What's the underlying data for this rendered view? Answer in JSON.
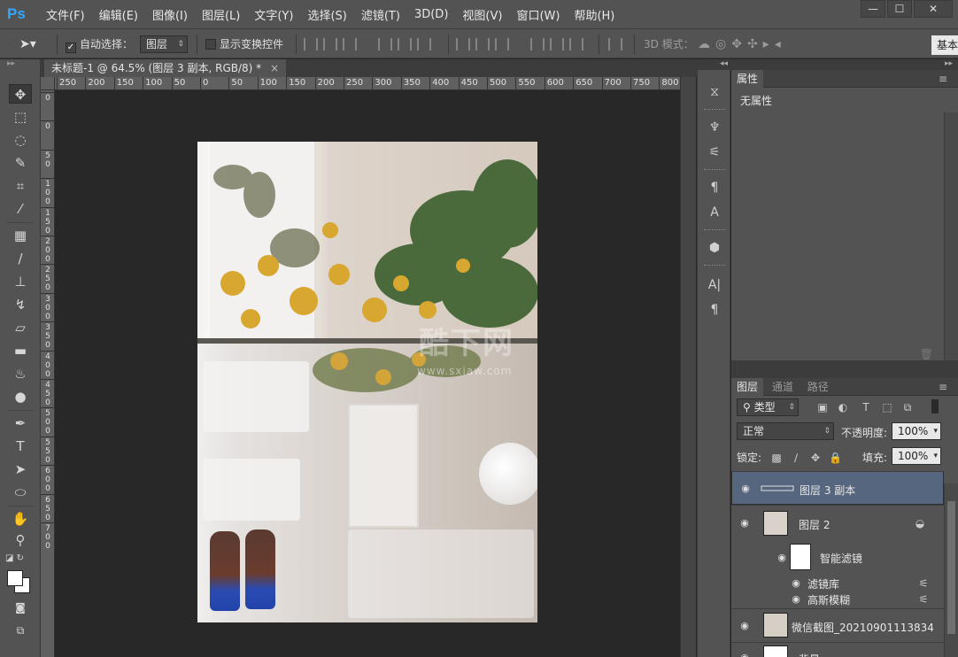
{
  "app": {
    "logo": "Ps",
    "menus": [
      "文件(F)",
      "编辑(E)",
      "图像(I)",
      "图层(L)",
      "文字(Y)",
      "选择(S)",
      "滤镜(T)",
      "3D(D)",
      "视图(V)",
      "窗口(W)",
      "帮助(H)"
    ],
    "window_buttons": {
      "minimize": "—",
      "maximize": "☐",
      "close": "✕"
    }
  },
  "options_bar": {
    "auto_select_label": "自动选择：",
    "auto_select_checked": true,
    "auto_select_target": "图层",
    "show_transform_label": "显示变换控件",
    "show_transform_checked": false,
    "mode_3d_label": "3D 模式：",
    "workspace": "基本"
  },
  "document": {
    "tab_title": "未标题-1 @ 64.5% (图层 3 副本, RGB/8) *",
    "tab_close": "×",
    "ruler_h": [
      "250",
      "200",
      "150",
      "100",
      "50",
      "0",
      "50",
      "100",
      "150",
      "200",
      "250",
      "300",
      "350",
      "400",
      "450",
      "500",
      "550",
      "600",
      "650",
      "700",
      "750",
      "800"
    ],
    "ruler_v": [
      "0",
      "0",
      "50",
      "100",
      "150",
      "200",
      "250",
      "300",
      "350",
      "400",
      "450",
      "500",
      "550",
      "600",
      "650",
      "700"
    ],
    "watermark": "酷下网",
    "watermark_url": "www.sxiaw.com"
  },
  "properties_panel": {
    "tab": "属性",
    "empty_text": "无属性"
  },
  "layers_panel": {
    "tabs": [
      "图层",
      "通道",
      "路径"
    ],
    "filter_kind": "类型",
    "blend_mode": "正常",
    "opacity_label": "不透明度:",
    "opacity_value": "100%",
    "lock_label": "锁定:",
    "fill_label": "填充:",
    "fill_value": "100%",
    "layers": [
      {
        "name": "图层 3 副本",
        "selected": true
      },
      {
        "name": "图层 2",
        "selected": false
      },
      {
        "name": "智能滤镜",
        "selected": false
      },
      {
        "name": "滤镜库",
        "selected": false
      },
      {
        "name": "高斯模糊",
        "selected": false
      },
      {
        "name": "微信截图_20210901113834",
        "selected": false
      },
      {
        "name": "背景",
        "selected": false
      }
    ]
  }
}
